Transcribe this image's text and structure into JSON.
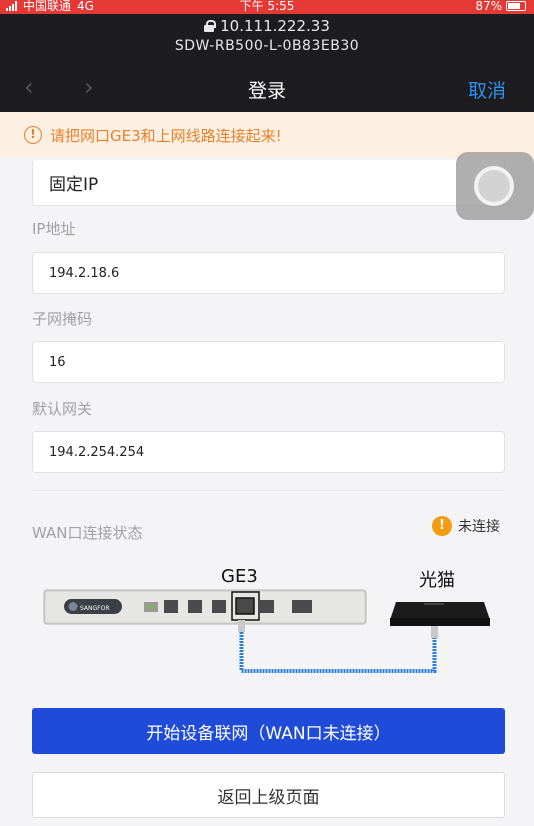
{
  "status_bar": {
    "carrier": "中国联通",
    "network": "4G",
    "time": "下午 5:55",
    "battery": "87%"
  },
  "browser": {
    "url": "10.111.222.33",
    "page_host": "SDW-RB500-L-0B83EB30"
  },
  "nav": {
    "back_icon": "chevron-left-icon",
    "forward_icon": "chevron-right-icon",
    "title": "登录",
    "cancel_label": "取消"
  },
  "banner": {
    "icon": "warning-icon",
    "text": "请把网口GE3和上网线路连接起来!"
  },
  "form": {
    "mode_value": "固定IP",
    "ip_label": "IP地址",
    "ip_value": "194.2.18.6",
    "mask_label": "子网掩码",
    "mask_value": "16",
    "gateway_label": "默认网关",
    "gateway_value": "194.2.254.254"
  },
  "wan": {
    "label": "WAN口连接状态",
    "status_text": "未连接",
    "status_color": "#f39c12"
  },
  "diagram": {
    "port_label": "GE3",
    "modem_label": "光猫",
    "router_brand": "SANGFOR",
    "cable_color": "#2b7fd6"
  },
  "buttons": {
    "primary_label": "开始设备联网（WAN口未连接）",
    "primary_color": "#1f4bd8",
    "secondary_label": "返回上级页面"
  }
}
